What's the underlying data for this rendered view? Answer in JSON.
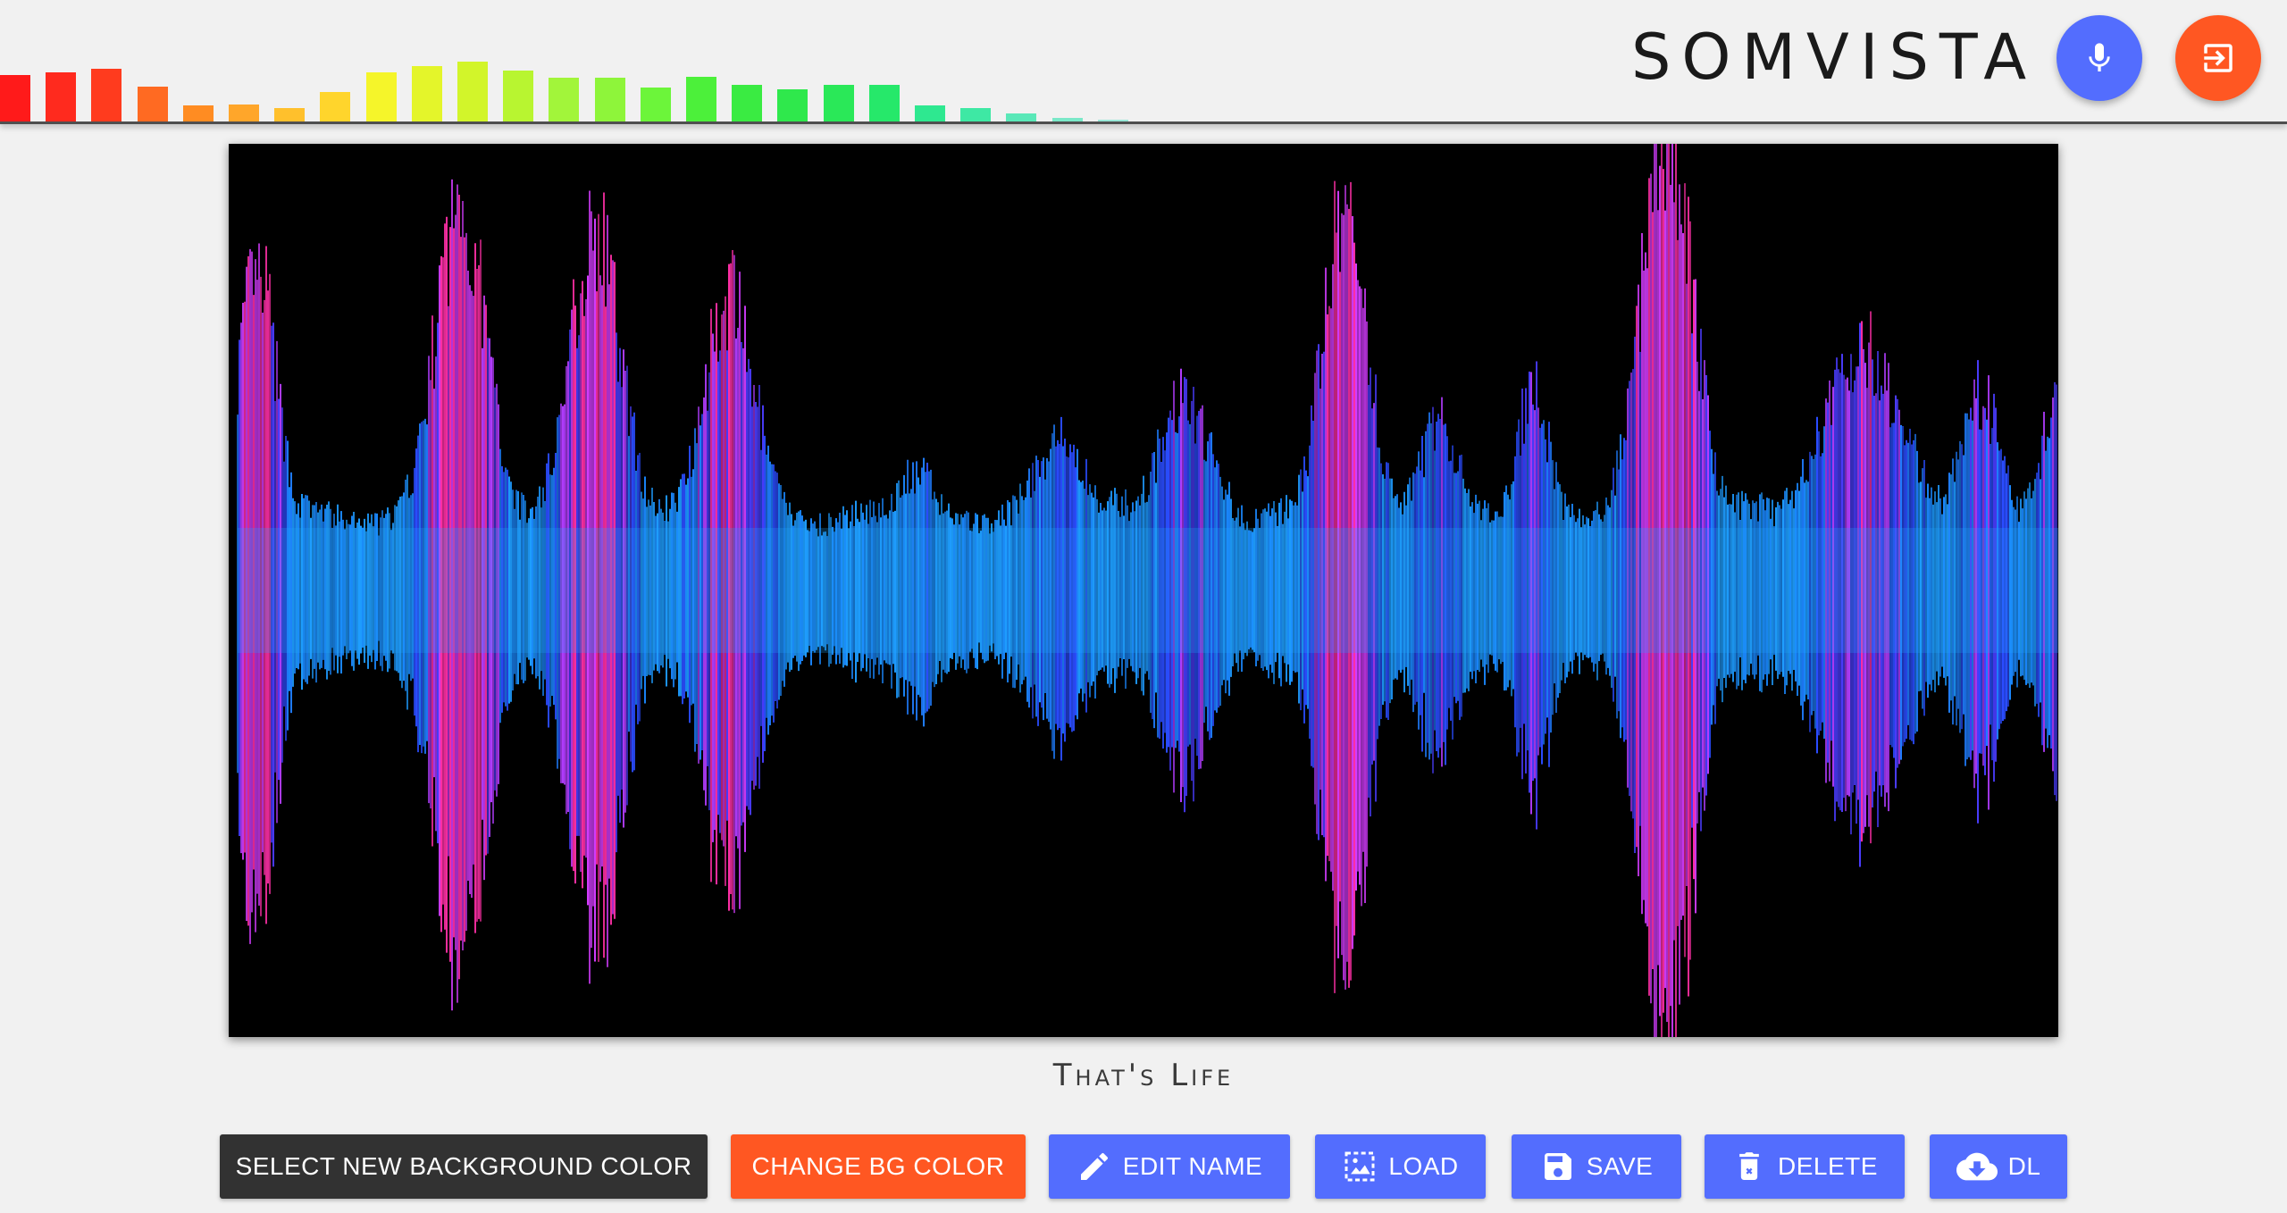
{
  "app": {
    "logo_text": "SOMVISTA"
  },
  "header": {
    "mic_button": {
      "icon": "microphone-icon",
      "color": "#536dfe"
    },
    "exit_button": {
      "icon": "exit-icon",
      "color": "#ff5722"
    }
  },
  "level_meter": {
    "levels": [
      0.44,
      0.47,
      0.5,
      0.33,
      0.15,
      0.16,
      0.13,
      0.28,
      0.47,
      0.53,
      0.57,
      0.49,
      0.42,
      0.42,
      0.32,
      0.43,
      0.35,
      0.31,
      0.35,
      0.35,
      0.15,
      0.13,
      0.08,
      0.03,
      0.02
    ],
    "colors": [
      "#ff1a1a",
      "#ff2a1e",
      "#ff3b1e",
      "#ff6a22",
      "#ff8c22",
      "#ffa62a",
      "#ffc02c",
      "#ffd52c",
      "#f5f52a",
      "#e4f52a",
      "#d2f52a",
      "#b8f530",
      "#a2f53a",
      "#8ef53a",
      "#6cf53a",
      "#4cf03a",
      "#3aeb42",
      "#2fe84c",
      "#2ae858",
      "#26e86a",
      "#2ee890",
      "#3ee8a4",
      "#5ae8b8",
      "#7ae8c8",
      "#9ae8d8"
    ]
  },
  "visualizer": {
    "background": "#000000"
  },
  "track": {
    "name": "That's Life"
  },
  "toolbar": {
    "select_bg": {
      "label": "SELECT NEW BACKGROUND COLOR",
      "color": "#323232"
    },
    "change_bg": {
      "label": "CHANGE BG COLOR",
      "color": "#ff5722"
    },
    "edit_name": {
      "label": "EDIT NAME",
      "icon": "pencil-icon",
      "color": "#536dfe"
    },
    "load": {
      "label": "LOAD",
      "icon": "image-load-icon",
      "color": "#536dfe"
    },
    "save": {
      "label": "SAVE",
      "icon": "floppy-disk-icon",
      "color": "#536dfe"
    },
    "delete": {
      "label": "DELETE",
      "icon": "trash-icon",
      "color": "#536dfe"
    },
    "download": {
      "label": "DL",
      "icon": "cloud-download-icon",
      "color": "#536dfe"
    }
  }
}
